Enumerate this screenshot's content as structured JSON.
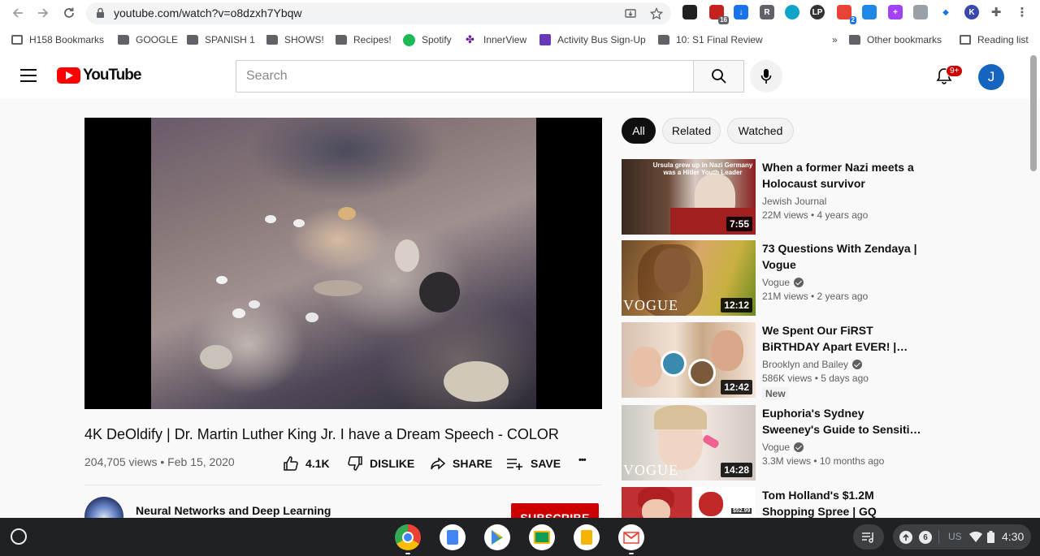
{
  "browser": {
    "url": "youtube.com/watch?v=o8dzxh7Ybqw",
    "extension_badge_count": "16",
    "extension_badge_count_2": "2",
    "bookmarks": [
      {
        "label": "H158 Bookmarks",
        "icon": "bookmark-page-icon"
      },
      {
        "label": "GOOGLE",
        "icon": "folder-icon"
      },
      {
        "label": "SPANISH 1",
        "icon": "folder-icon"
      },
      {
        "label": "SHOWS!",
        "icon": "folder-icon"
      },
      {
        "label": "Recipes!",
        "icon": "folder-icon"
      },
      {
        "label": "Spotify",
        "icon": "spotify-icon"
      },
      {
        "label": "InnerView",
        "icon": "innerview-icon"
      },
      {
        "label": "Activity Bus Sign-Up",
        "icon": "forms-icon"
      },
      {
        "label": "10: S1 Final Review",
        "icon": "folder-icon"
      }
    ],
    "more_bookmarks": "»",
    "other_bookmarks": "Other bookmarks",
    "reading_list": "Reading list"
  },
  "youtube": {
    "logo_text": "YouTube",
    "search_placeholder": "Search",
    "notification_count": "9+",
    "avatar_initial": "J"
  },
  "video": {
    "title": "4K DeOldify | Dr. Martin Luther King Jr. I have a Dream Speech - COLOR",
    "meta": "204,705 views • Feb 15, 2020",
    "likes": "4.1K",
    "dislike_label": "DISLIKE",
    "share_label": "SHARE",
    "save_label": "SAVE",
    "more": "•••",
    "channel_name": "Neural Networks and Deep Learning",
    "subscribe_label": "SUBSCRIBE"
  },
  "chips": [
    "All",
    "Related",
    "Watched"
  ],
  "recommendations": [
    {
      "title": "When a former Nazi meets a Holocaust survivor",
      "channel": "Jewish Journal",
      "verified": false,
      "stats": "22M views • 4 years ago",
      "duration": "7:55",
      "thumb_overlay": "Ursula grew up in Nazi Germany was a Hitler Youth Leader"
    },
    {
      "title": "73 Questions With Zendaya | Vogue",
      "channel": "Vogue",
      "verified": true,
      "stats": "21M views • 2 years ago",
      "duration": "12:12",
      "thumb_overlay": "VOGUE"
    },
    {
      "title": "We Spent Our FiRST BiRTHDAY Apart EVER! | Brooklyn & Baile…",
      "channel": "Brooklyn and Bailey",
      "verified": true,
      "stats": "586K views • 5 days ago",
      "duration": "12:42",
      "badge": "New"
    },
    {
      "title": "Euphoria's Sydney Sweeney's Guide to Sensitive Skin Care…",
      "channel": "Vogue",
      "verified": true,
      "stats": "3.3M views • 10 months ago",
      "duration": "14:28",
      "thumb_overlay": "VOGUE"
    },
    {
      "title": "Tom Holland's $1.2M Shopping Spree | GQ",
      "channel": "",
      "verified": false,
      "stats": "",
      "duration": "",
      "thumb_overlay": "$52.99"
    }
  ],
  "shelf": {
    "apps": [
      "chrome-icon",
      "docs-icon",
      "play-store-icon",
      "classroom-icon",
      "slides-icon",
      "gmail-icon"
    ],
    "tray_count": "6",
    "locale": "US",
    "time": "4:30"
  },
  "colors": {
    "youtube_red": "#ff0000",
    "subscribe_red": "#cc0000",
    "avatar_blue": "#1565c0",
    "shelf_bg": "#202124"
  }
}
